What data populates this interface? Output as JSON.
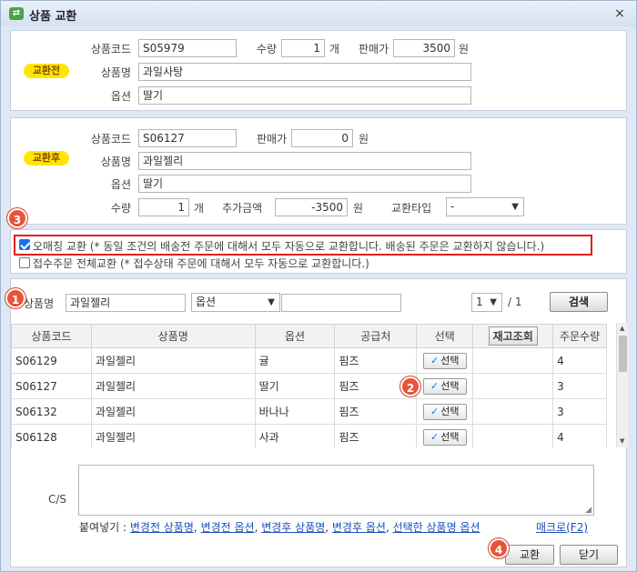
{
  "window": {
    "title": "상품 교환",
    "close": "×"
  },
  "before": {
    "badge": "교환전",
    "code_label": "상품코드",
    "code": "S05979",
    "qty_label": "수량",
    "qty": "1",
    "qty_unit": "개",
    "price_label": "판매가",
    "price": "3500",
    "price_unit": "원",
    "name_label": "상품명",
    "name": "과일사탕",
    "option_label": "옵션",
    "option": "딸기"
  },
  "after": {
    "badge": "교환후",
    "code_label": "상품코드",
    "code": "S06127",
    "price_label": "판매가",
    "price": "0",
    "price_unit": "원",
    "name_label": "상품명",
    "name": "과일젤리",
    "option_label": "옵션",
    "option": "딸기",
    "qty_label": "수량",
    "qty": "1",
    "qty_unit": "개",
    "extra_label": "추가금액",
    "extra": "-3500",
    "extra_unit": "원",
    "type_label": "교환타입",
    "type_value": "-"
  },
  "options": {
    "auto_match": "오매칭 교환 (* 동일 조건의 배송전 주문에 대해서 모두 자동으로 교환합니다. 배송된 주문은 교환하지 않습니다.)",
    "received_all": "접수주문 전체교환 (* 접수상태 주문에 대해서 모두 자동으로 교환합니다.)"
  },
  "search": {
    "name_label": "상품명",
    "name": "과일젤리",
    "option_select": "옵션",
    "option_text": "",
    "page": "1",
    "page_total": "/ 1",
    "button": "검색"
  },
  "table": {
    "headers": [
      "상품코드",
      "상품명",
      "옵션",
      "공급처",
      "선택",
      "재고조회",
      "주문수량"
    ],
    "select_label": "선택",
    "rows": [
      {
        "code": "S06129",
        "name": "과일젤리",
        "option": "귤",
        "supplier": "핌즈",
        "qty": "4"
      },
      {
        "code": "S06127",
        "name": "과일젤리",
        "option": "딸기",
        "supplier": "핌즈",
        "qty": "3"
      },
      {
        "code": "S06132",
        "name": "과일젤리",
        "option": "바나나",
        "supplier": "핌즈",
        "qty": "3"
      },
      {
        "code": "S06128",
        "name": "과일젤리",
        "option": "사과",
        "supplier": "핌즈",
        "qty": "4"
      }
    ]
  },
  "cs": {
    "label": "C/S",
    "memo": "",
    "paste_label": "붙여넣기 :",
    "links": [
      "변경전 상품명",
      "변경전 옵션",
      "변경후 상품명",
      "변경후 옵션",
      "선택한 상품명 옵션"
    ],
    "macro": "매크로(F2)"
  },
  "footer": {
    "exchange": "교환",
    "close": "닫기"
  },
  "steps": {
    "s1": "1",
    "s2": "2",
    "s3": "3",
    "s4": "4"
  },
  "colors": {
    "badge": "#ffe600",
    "step": "#e8543a",
    "highlight": "#e02020"
  }
}
